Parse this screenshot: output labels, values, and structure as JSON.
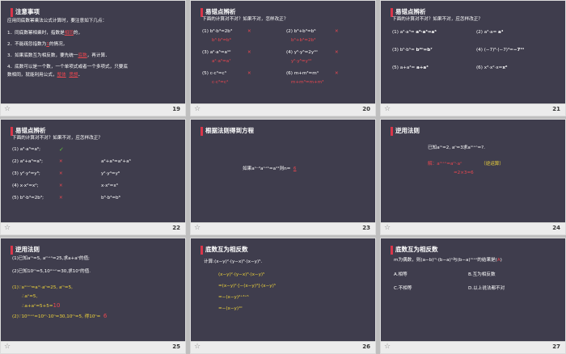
{
  "slides": [
    {
      "number": "19",
      "title": "注意事项",
      "lines": [
        "应用同底数幂乘法公式计算时，要注意如下几点：",
        "1．同底数幂相乘时，指数是",
        "相同",
        "的，",
        "2．不能疏忽指数为",
        "1",
        "的情况，",
        "3．如果底数互为相反数，要先统一",
        "底数",
        "，再计算．",
        "4．底数可以是一个数，一个单项式或者一个多项式，只要底",
        "数相同，就能利用公式，",
        "整体",
        "思想",
        "．"
      ]
    },
    {
      "number": "20",
      "title": "易错点辨析",
      "question": "下面的计算对不对？如果不对，怎样改正？",
      "items": [
        {
          "q": "(1) b³·b³=2b³",
          "mark": "✕",
          "fix": "b³·b³=b⁶"
        },
        {
          "q": "(2) b³+b³=b⁶",
          "mark": "✕",
          "fix": "b³+b³=2b³"
        },
        {
          "q": "(3) a²·a⁵=a¹⁰",
          "mark": "✕",
          "fix": "a²·a⁵=a⁷"
        },
        {
          "q": "(4) y⁵·y⁵=2y¹⁰",
          "mark": "✕",
          "fix": "y⁵·y⁵=y¹⁰"
        },
        {
          "q": "(5) c·c³=c³",
          "mark": "✕",
          "fix": "c·c³=c⁴"
        },
        {
          "q": "(6) m+m³=m⁴",
          "mark": "✕",
          "fix": "m+m³=m+m³"
        }
      ]
    },
    {
      "number": "21",
      "title": "易错点辨析",
      "question": "下面的计算对不对？如果不对，应怎样改正？",
      "items": [
        {
          "q": "(1) a³·a³=",
          "a": "a⁹·a³=a⁶"
        },
        {
          "q": "(2) a³·a=",
          "a": "a⁴"
        },
        {
          "q": "(3) b⁵·b⁵=",
          "a": "b²ⁿ=b⁷"
        },
        {
          "q": "(4) (−7)⁸·(−7)³=",
          "a": "−7¹¹"
        },
        {
          "q": "(5) a+a³=",
          "a": "a+a³"
        },
        {
          "q": "(6) x³·x²·x=",
          "a": "x⁶"
        }
      ]
    },
    {
      "number": "22",
      "title": "易错点辨析",
      "question": "下面的计算对不对？如果不对，应怎样改正？",
      "items": [
        {
          "q": "(1) a³·a³=a⁶;",
          "mark": "✓",
          "fix": ""
        },
        {
          "q": "(2) a²+a³=a⁵;",
          "mark": "✕",
          "fix": "a²+a³=a²+a³"
        },
        {
          "q": "(3) y²·y⁴=y⁸;",
          "mark": "✕",
          "fix": "y²·y⁴=y⁶"
        },
        {
          "q": "(4) x·x²=x²;",
          "mark": "✕",
          "fix": "x·x²=x³"
        },
        {
          "q": "(5) b³·b³=2b³;",
          "mark": "✕",
          "fix": "b³·b³=b⁶"
        }
      ]
    },
    {
      "number": "23",
      "title": "根据法则得到方程",
      "text": "如果aⁿ⁻²aⁿ⁺¹=a¹¹则n=",
      "answer": "6"
    },
    {
      "number": "24",
      "title": "逆用法则",
      "text": "已知aᵐ=2, aⁿ=3求aᵐ⁺ⁿ=?.",
      "sol": "解：aᵐ⁺ⁿ=aᵐ·aⁿ",
      "note": "（逆运算）",
      "sol2": "=2×3=6"
    },
    {
      "number": "25",
      "title": "逆用法则",
      "l1": "(1)已知aᵐ=5, aᵐ⁺ⁿ=25,求a+aⁿ的值;",
      "l2": "(2)已知10ᵐ=5,10ᵐ⁺ⁿ=30,求10ⁿ的值.",
      "s1": "(1)∵aᵐ⁺ⁿ=aᵐ·aⁿ=25, aᵐ=5,",
      "s2": "∴aⁿ=5,",
      "s3": "∴a+aⁿ=5+5=",
      "s3v": "10",
      "s4": "(2)∵10ᵐ⁺ⁿ=10ᵐ·10ⁿ=30,10ᵐ=5, 得10ⁿ=",
      "s4v": "6"
    },
    {
      "number": "26",
      "title": "底数互为相反数",
      "calc": "计算:(x−y)²·(y−x)³·(x−y)⁵.",
      "steps": [
        "(x−y)²·(y−x)³·(x−y)⁵",
        "=(x−y)²·[−(x−y)³]·(x−y)⁵",
        "=−(x−y)²⁺³⁺⁵",
        "=−(x−y)¹⁰"
      ]
    },
    {
      "number": "27",
      "title": "底数互为相反数",
      "q": "m为偶数，则(a−b)ᵐ·(b−a)ⁿ与(b−a)ᵐ⁺ⁿ的结果是(",
      "qans": "A",
      "opts": [
        "A.相等",
        "B.互为相反数",
        "C.不相等",
        "D.以上说法都不对"
      ]
    }
  ],
  "footer_icon": "star-icon"
}
